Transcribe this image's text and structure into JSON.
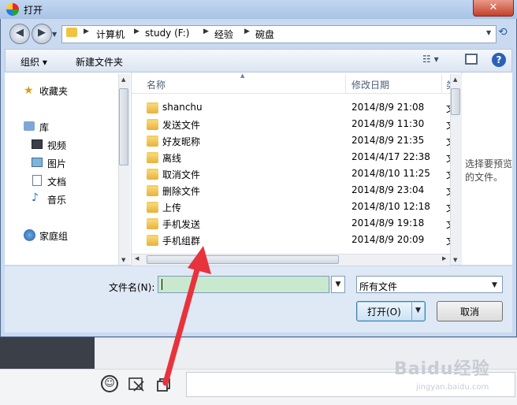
{
  "window": {
    "title": "打开",
    "close": "✕"
  },
  "breadcrumb": [
    "计算机",
    "study (F:)",
    "经验",
    "碗盘"
  ],
  "toolbar": {
    "organize": "组织",
    "new_folder": "新建文件夹"
  },
  "nav": [
    {
      "label": "收藏夹",
      "icon": "star-icon"
    },
    {
      "label": "库",
      "icon": "library-icon"
    },
    {
      "label": "视频",
      "icon": "video-icon"
    },
    {
      "label": "图片",
      "icon": "picture-icon"
    },
    {
      "label": "文档",
      "icon": "document-icon"
    },
    {
      "label": "音乐",
      "icon": "music-icon"
    },
    {
      "label": "家庭组",
      "icon": "homegroup-icon"
    }
  ],
  "columns": {
    "name": "名称",
    "date": "修改日期",
    "type": "类"
  },
  "files": [
    {
      "name": "shanchu",
      "date": "2014/8/9 21:08",
      "type": "文"
    },
    {
      "name": "发送文件",
      "date": "2014/8/9 11:30",
      "type": "文"
    },
    {
      "name": "好友昵称",
      "date": "2014/8/9 21:35",
      "type": "文"
    },
    {
      "name": "离线",
      "date": "2014/4/17 22:38",
      "type": "文"
    },
    {
      "name": "取消文件",
      "date": "2014/8/10 11:25",
      "type": "文"
    },
    {
      "name": "删除文件",
      "date": "2014/8/9 23:04",
      "type": "文"
    },
    {
      "name": "上传",
      "date": "2014/8/10 12:18",
      "type": "文"
    },
    {
      "name": "手机发送",
      "date": "2014/8/9 19:18",
      "type": "文"
    },
    {
      "name": "手机组群",
      "date": "2014/8/9 20:09",
      "type": "文"
    }
  ],
  "preview": {
    "text": "选择要预览的文件。"
  },
  "filename": {
    "label": "文件名(N):",
    "value": ""
  },
  "filetype": {
    "value": "所有文件"
  },
  "buttons": {
    "open": "打开(O)",
    "cancel": "取消"
  },
  "watermark": {
    "brand": "Baidu经验",
    "sub": "jingyan.baidu.com"
  },
  "colors": {
    "accent": "#3c7fb1",
    "arrow": "#e8323c",
    "filename_bg": "#c9e9cf"
  }
}
